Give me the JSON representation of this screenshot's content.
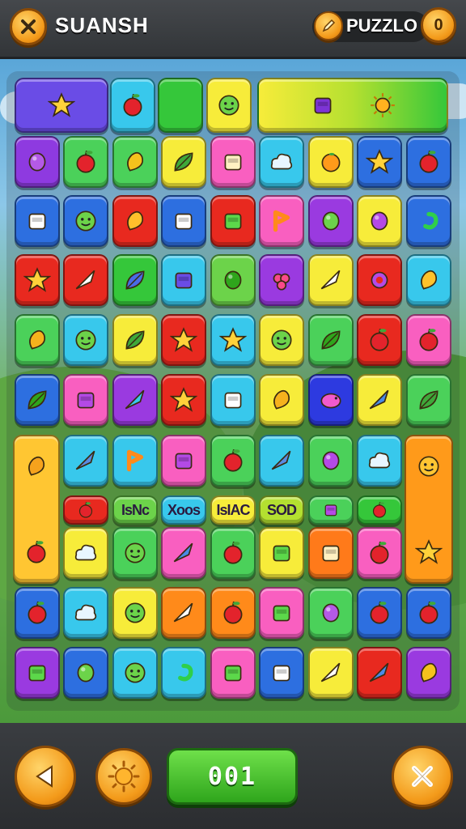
{
  "header": {
    "title": "SUANSH",
    "puzzle_label": "PUZZLO",
    "coin_value": "0"
  },
  "board": {
    "rows": [
      [
        "star",
        "apple",
        "",
        "face",
        "jar",
        "sun"
      ],
      [
        "berry",
        "apple",
        "lemon",
        "leaf",
        "dice",
        "cloud",
        "orange",
        "star",
        "apple"
      ],
      [
        "jar",
        "face",
        "pepper",
        "jar",
        "box",
        "flag",
        "ring",
        "balloon",
        "swirl"
      ],
      [
        "star",
        "plane",
        "feather",
        "camera",
        "ball",
        "grapes",
        "plane",
        "gear",
        "banana"
      ],
      [
        "pear",
        "face",
        "leaf",
        "star",
        "star",
        "face",
        "palm",
        "apple",
        "apple"
      ],
      [
        "palm",
        "bag",
        "hammer",
        "star",
        "jar",
        "pear",
        "pig",
        "pencil",
        "leaf"
      ],
      [
        "pear",
        "tool",
        "flag",
        "bag",
        "apple",
        "tool",
        "balloon",
        "cloud",
        "face"
      ],
      [
        "apple",
        "cloud",
        "face",
        "pencil",
        "apple",
        "box",
        "dice",
        "apple",
        "star"
      ],
      [
        "apple",
        "cloud",
        "face",
        "plane",
        "apple",
        "box",
        "berry",
        "apple",
        "apple"
      ],
      [
        "box",
        "ring",
        "face",
        "swirl",
        "box",
        "calendar",
        "plane",
        "pencil",
        "lemon"
      ]
    ],
    "word_strip": [
      "apple",
      "IsNc",
      "Xoos",
      "IsIAC",
      "SOD",
      "box",
      "apple"
    ]
  },
  "footer": {
    "score": "001",
    "buttons": [
      "back-arrow-icon",
      "sun-icon",
      "close-icon"
    ]
  }
}
